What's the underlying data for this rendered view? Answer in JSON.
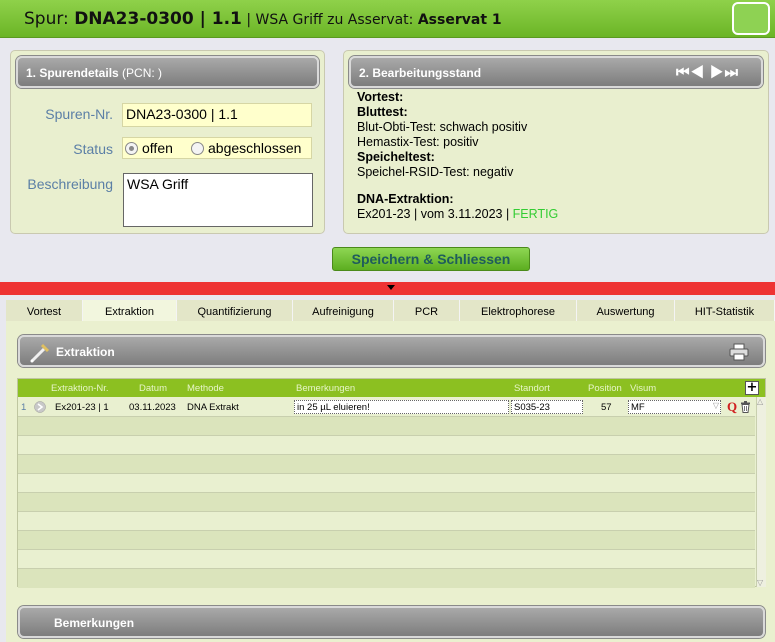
{
  "title": {
    "prefix": "Spur: ",
    "spur_id": "DNA23-0300 | 1.1",
    "separator": " | ",
    "mid": "WSA Griff zu Asservat: ",
    "asservat": "Asservat 1"
  },
  "panel1": {
    "title": "1. Spurendetails",
    "pcn": " (PCN: )",
    "spuren_nr_label": "Spuren-Nr.",
    "spuren_nr_value": "DNA23-0300 | 1.1",
    "status_label": "Status",
    "status_options": [
      "offen",
      "abgeschlossen"
    ],
    "status_selected": "offen",
    "beschreibung_label": "Beschreibung",
    "beschreibung_value": "WSA Griff"
  },
  "panel2": {
    "title": "2. Bearbeitungsstand",
    "lines": {
      "vortest": "Vortest:",
      "bluttest": "Bluttest:",
      "blut_obti": "Blut-Obti-Test: schwach positiv",
      "hemastix": "Hemastix-Test: positiv",
      "speicheltest": "Speicheltest:",
      "speichel_rsid": "Speichel-RSID-Test: negativ",
      "dna_extraktion": "DNA-Extraktion:",
      "extraktion_info": "Ex201-23 | vom 3.11.2023 | ",
      "extraktion_status": "FERTIG"
    }
  },
  "save_button": "Speichern & Schliessen",
  "tabs": [
    {
      "label": "Vortest",
      "active": false
    },
    {
      "label": "Extraktion",
      "active": true
    },
    {
      "label": "Quantifizierung",
      "active": false
    },
    {
      "label": "Aufreinigung",
      "active": false
    },
    {
      "label": "PCR",
      "active": false
    },
    {
      "label": "Elektrophorese",
      "active": false
    },
    {
      "label": "Auswertung",
      "active": false
    },
    {
      "label": "HIT-Statistik",
      "active": false
    }
  ],
  "extraktion": {
    "title": "Extraktion",
    "columns": [
      "Extraktion-Nr.",
      "Datum",
      "Methode",
      "Bemerkungen",
      "Standort",
      "Position",
      "Visum"
    ],
    "rows": [
      {
        "index": "1",
        "nr": "Ex201-23 | 1",
        "datum": "03.11.2023",
        "methode": "DNA Extrakt",
        "bemerkungen": "in 25 µL eluieren!",
        "standort": "S035-23",
        "position": "57",
        "visum": "MF"
      }
    ]
  },
  "bemerkungen_title": "Bemerkungen",
  "colors": {
    "titlebar": "#7ec23a",
    "grid_header": "#8cc021",
    "red_bar": "#ee3333",
    "status_ok": "#33cc33",
    "field_label": "#5b7fa6"
  }
}
